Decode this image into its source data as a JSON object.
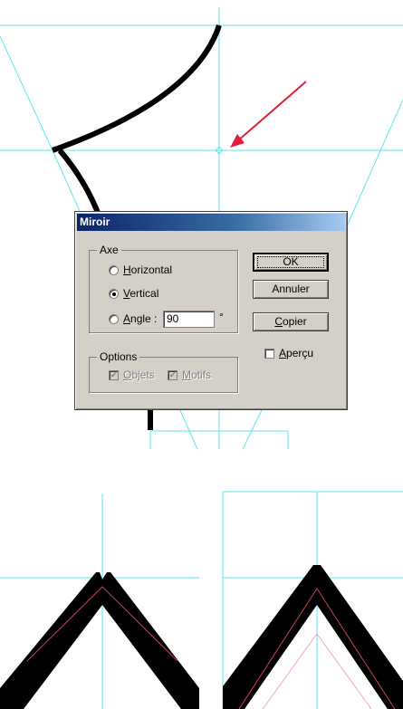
{
  "dialog": {
    "title": "Miroir",
    "axe_group": {
      "legend": "Axe",
      "horizontal": {
        "prefix": "",
        "accel": "H",
        "rest": "orizontal",
        "selected": false
      },
      "vertical": {
        "prefix": "",
        "accel": "V",
        "rest": "ertical",
        "selected": true
      },
      "angle": {
        "prefix": "",
        "accel": "A",
        "rest": "ngle :",
        "selected": false
      },
      "angle_value": "90",
      "angle_unit": "°"
    },
    "options_group": {
      "legend": "Options",
      "objets": {
        "prefix": "",
        "accel": "O",
        "rest": "bjets",
        "checked": true,
        "enabled": false
      },
      "motifs": {
        "prefix": "",
        "accel": "M",
        "rest": "otifs",
        "checked": true,
        "enabled": false
      }
    },
    "buttons": {
      "ok": "OK",
      "annuler": "Annuler",
      "copier_accel": "C",
      "copier_rest": "opier"
    },
    "apercu": {
      "prefix": "",
      "accel": "A",
      "rest": "perçu",
      "checked": false
    }
  },
  "colors": {
    "guide": "#5ee6ee",
    "path": "#000000",
    "arrow": "#e0203a",
    "dialog_bg": "#d4d0c8",
    "title_start": "#0a246a",
    "title_end": "#a6caf0"
  }
}
